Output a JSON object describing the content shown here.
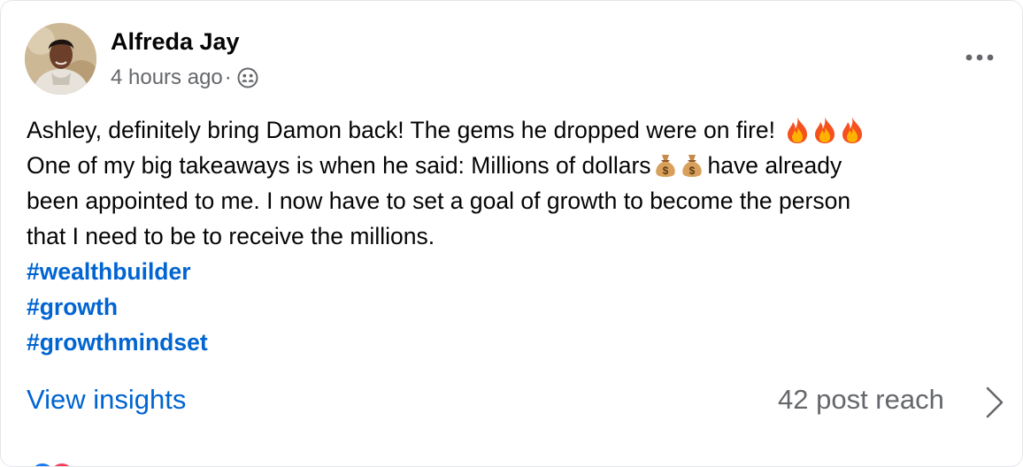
{
  "author": {
    "name": "Alfreda Jay",
    "timestamp": "4 hours ago",
    "separator": "·",
    "privacy_icon": "friends-group-icon"
  },
  "menu": {
    "more_icon": "more-horizontal-icon"
  },
  "post": {
    "line1": "Ashley, definitely bring Damon back! The gems he dropped were on fire!",
    "line2_before": "One of my big takeaways is when he said: Millions of dollars",
    "line2_after": "have already",
    "line3": "been appointed to me. I now have to set a goal of growth to become the person",
    "line4": "that I need to be to receive the millions.",
    "emoji_fire": "fire-emoji",
    "emoji_money": "money-bag-emoji",
    "hashtags": [
      "#wealthbuilder",
      "#growth",
      "#growthmindset"
    ]
  },
  "footer": {
    "view_insights": "View insights",
    "reach": "42 post reach",
    "chevron_icon": "chevron-right-icon"
  },
  "colors": {
    "link": "#0064d1",
    "secondary_text": "#65676b",
    "primary_text": "#050505"
  }
}
